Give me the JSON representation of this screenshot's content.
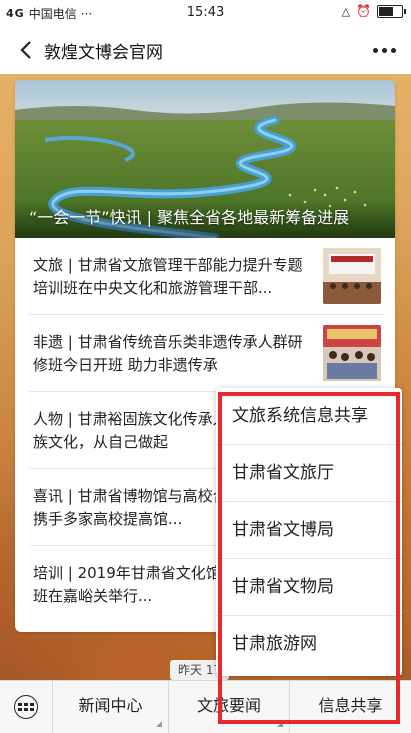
{
  "status_bar": {
    "carrier": "中国电信",
    "signal": "4G",
    "dots": "···",
    "time": "15:43"
  },
  "nav": {
    "title": "敦煌文博会官网"
  },
  "hero": {
    "caption": "“一会一节”快讯 | 聚焦全省各地最新筹备进展"
  },
  "news": [
    {
      "text": "文旅 | 甘肃省文旅管理干部能力提升专题培训班在中央文化和旅游管理干部..."
    },
    {
      "text": "非遗 | 甘肃省传统音乐类非遗传承人群研修班今日开班 助力非遗传承"
    },
    {
      "text": "人物 | 甘肃裕固族文化传承人斯：传承民族文化，从自己做起"
    },
    {
      "text": "喜讯 | 甘肃省博物馆与高校合作成立 省博携手多家高校提高馆..."
    },
    {
      "text": "培训 | 2019年甘肃省文化馆从业人员培训班在嘉峪关举行..."
    }
  ],
  "date_label": "昨天 17",
  "menu": {
    "m1": "新闻中心",
    "m2": "文旅要闻",
    "m3": "信息共享"
  },
  "popup": {
    "items": [
      "文旅系统信息共享",
      "甘肃省文旅厅",
      "甘肃省文博局",
      "甘肃省文物局",
      "甘肃旅游网"
    ]
  },
  "colors": {
    "highlight": "#e8282a"
  }
}
